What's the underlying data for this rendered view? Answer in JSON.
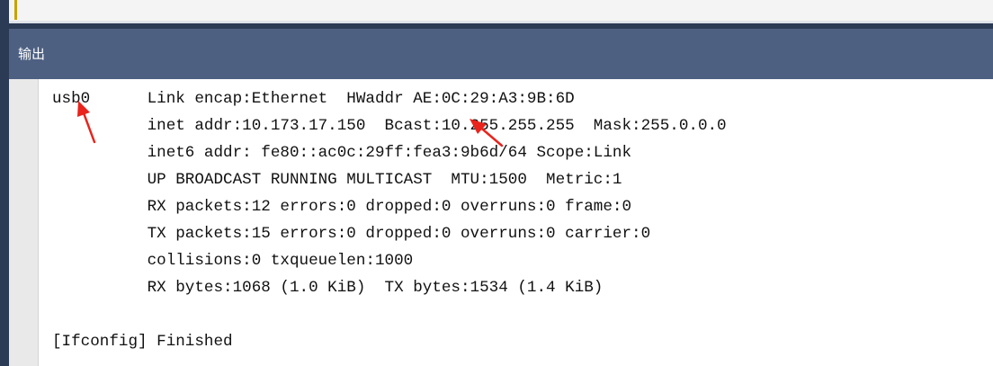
{
  "panel": {
    "title": "输出"
  },
  "output": {
    "lines": [
      "usb0      Link encap:Ethernet  HWaddr AE:0C:29:A3:9B:6D",
      "          inet addr:10.173.17.150  Bcast:10.255.255.255  Mask:255.0.0.0",
      "          inet6 addr: fe80::ac0c:29ff:fea3:9b6d/64 Scope:Link",
      "          UP BROADCAST RUNNING MULTICAST  MTU:1500  Metric:1",
      "          RX packets:12 errors:0 dropped:0 overruns:0 frame:0",
      "          TX packets:15 errors:0 dropped:0 overruns:0 carrier:0",
      "          collisions:0 txqueuelen:1000",
      "          RX bytes:1068 (1.0 KiB)  TX bytes:1534 (1.4 KiB)",
      "",
      "[Ifconfig] Finished"
    ]
  },
  "annotation_color": "#e8241c"
}
